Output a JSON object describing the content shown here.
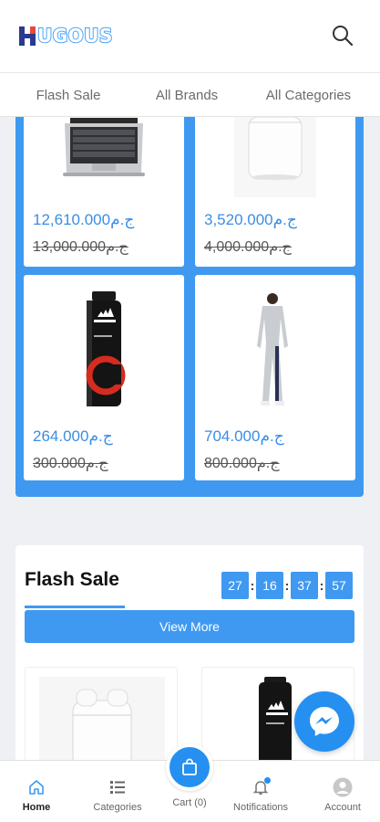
{
  "header": {
    "logo_text": "UGOUS",
    "search_icon": "search-icon"
  },
  "tabs": [
    "Flash Sale",
    "All Brands",
    "All Categories"
  ],
  "products": [
    {
      "name": "laptop",
      "price": "12,610.000ج.م",
      "old_price": "13,000.000ج.م"
    },
    {
      "name": "airpods",
      "price": "3,520.000ج.م",
      "old_price": "4,000.000ج.م"
    },
    {
      "name": "adidas-deodorant",
      "price": "264.000ج.م",
      "old_price": "300.000ج.م"
    },
    {
      "name": "tracksuit",
      "price": "704.000ج.م",
      "old_price": "800.000ج.م"
    }
  ],
  "flash_sale": {
    "title": "Flash Sale",
    "timer": [
      "27",
      "16",
      "37",
      "57"
    ],
    "timer_separator": ":",
    "view_more": "View More"
  },
  "bottom_nav": {
    "home": "Home",
    "categories": "Categories",
    "cart": "Cart (0)",
    "notifications": "Notifications",
    "account": "Account"
  },
  "colors": {
    "accent": "#3f99f1",
    "price": "#3b8de6",
    "messenger": "#2590f0"
  }
}
